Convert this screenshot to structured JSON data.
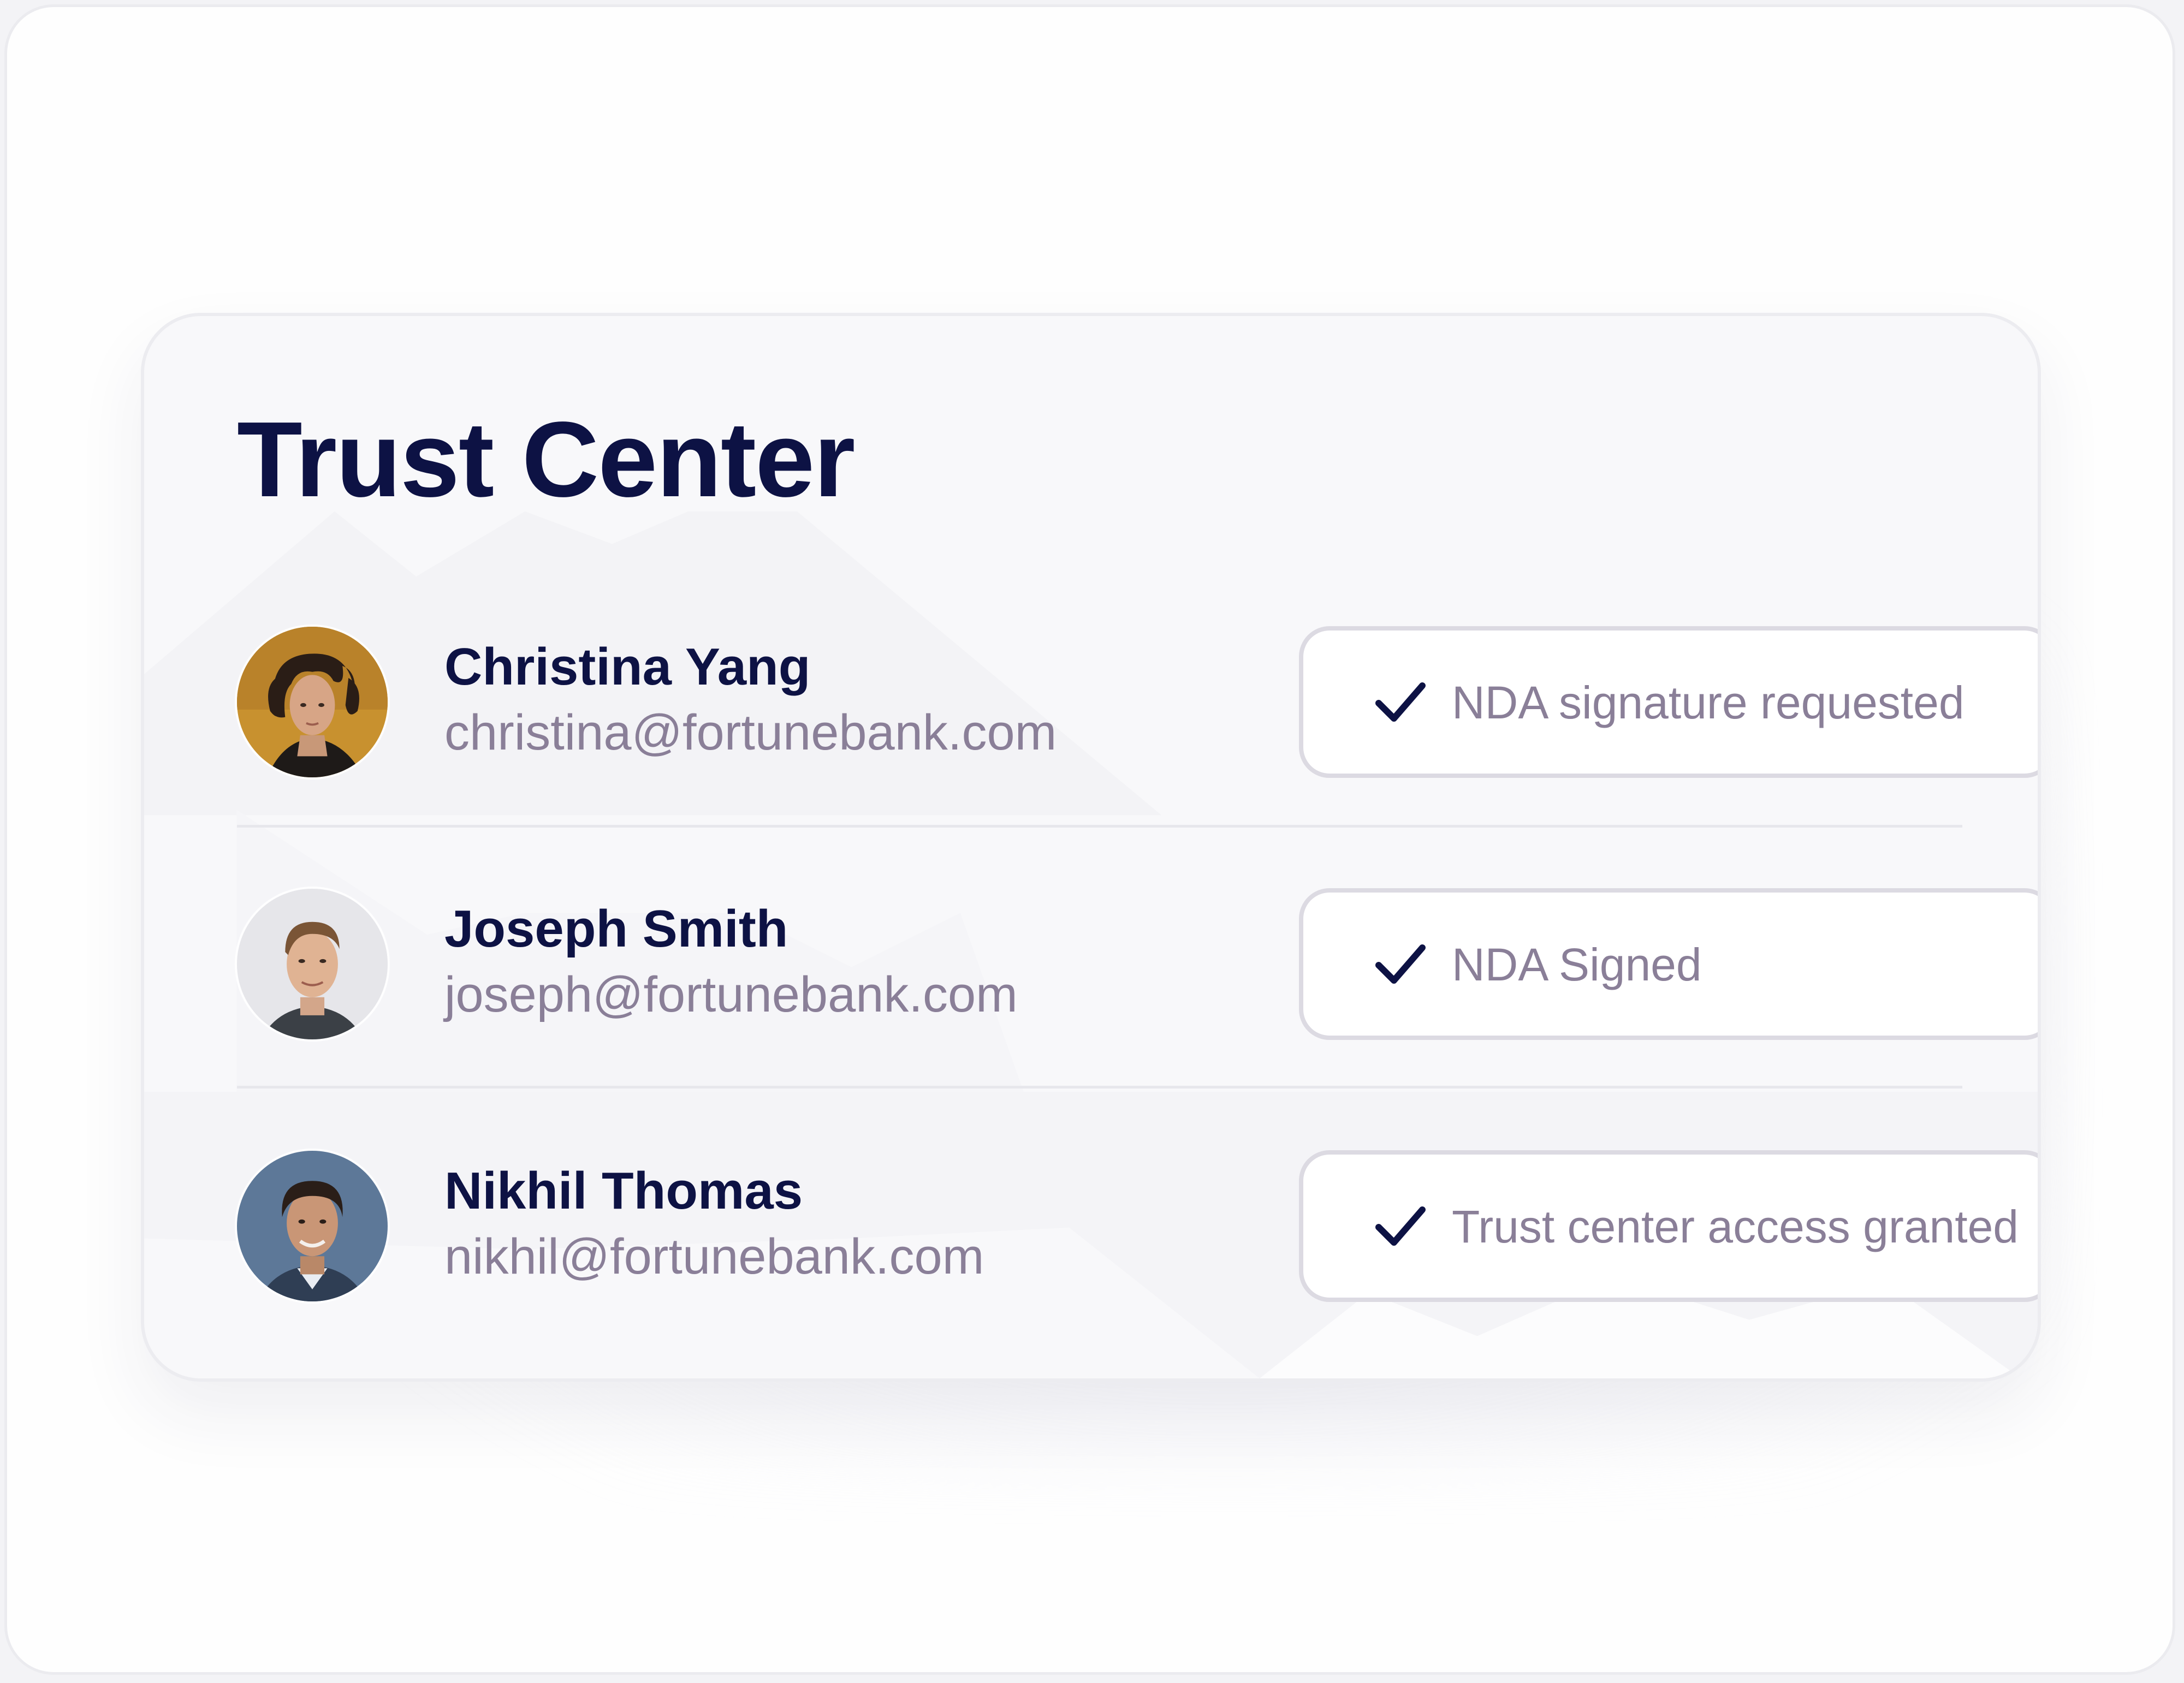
{
  "title": "Trust Center",
  "colors": {
    "title": "#0d1244",
    "email": "#8a7f98",
    "pill_border": "#dcdae2",
    "check": "#0d1244"
  },
  "people": [
    {
      "name": "Christina Yang",
      "email": "christina@fortunebank.com",
      "status": "NDA signature requested",
      "status_icon": "check-icon"
    },
    {
      "name": "Joseph Smith",
      "email": "joseph@fortunebank.com",
      "status": "NDA Signed",
      "status_icon": "check-icon"
    },
    {
      "name": "Nikhil Thomas",
      "email": "nikhil@fortunebank.com",
      "status": "Trust center access granted",
      "status_icon": "check-icon"
    }
  ]
}
